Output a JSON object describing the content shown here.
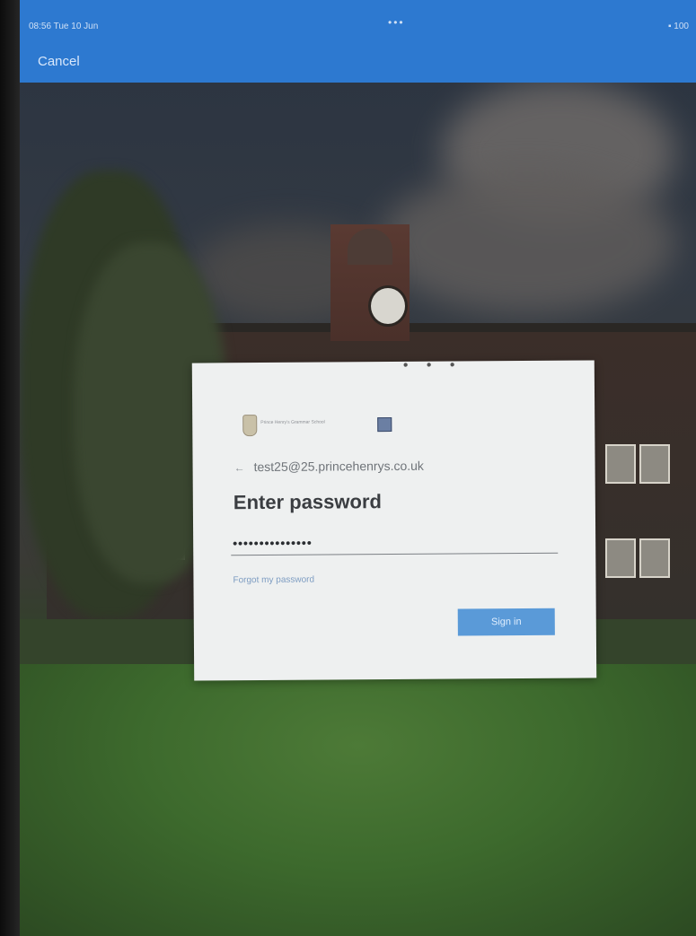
{
  "status_bar": {
    "time": "08:56 Tue 10 Jun",
    "center_indicator": "•••",
    "battery": "▪ 100"
  },
  "nav": {
    "cancel_label": "Cancel"
  },
  "dialog": {
    "loading_indicator": "• • •",
    "logo_text": "Prince Henry's Grammar School",
    "identity": "test25@25.princehenrys.co.uk",
    "back_icon": "←",
    "title": "Enter password",
    "password_value": "•••••••••••••••",
    "forgot_label": "Forgot my password",
    "signin_label": "Sign in"
  },
  "colors": {
    "nav_bar": "#2d79d0",
    "signin_button": "#5a9ad8",
    "dialog_bg": "#eef0f0"
  },
  "icons": {
    "back": "back-arrow-icon",
    "logo": "school-crest-icon"
  }
}
